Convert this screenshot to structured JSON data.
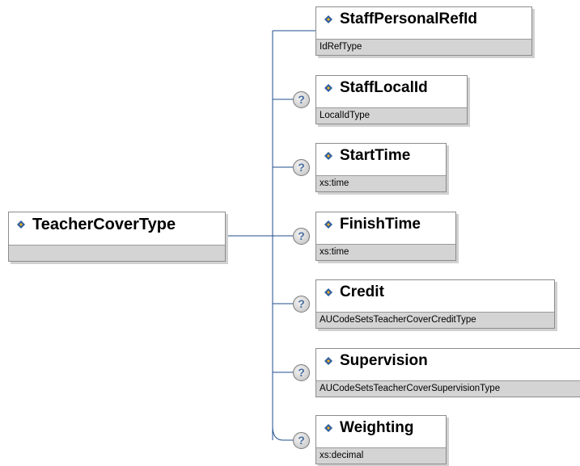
{
  "root": {
    "name": "TeacherCoverType",
    "type": ""
  },
  "children": [
    {
      "name": "StaffPersonalRefId",
      "type": "IdRefType",
      "optional": false
    },
    {
      "name": "StaffLocalId",
      "type": "LocalIdType",
      "optional": true
    },
    {
      "name": "StartTime",
      "type": "xs:time",
      "optional": true
    },
    {
      "name": "FinishTime",
      "type": "xs:time",
      "optional": true
    },
    {
      "name": "Credit",
      "type": "AUCodeSetsTeacherCoverCreditType",
      "optional": true
    },
    {
      "name": "Supervision",
      "type": "AUCodeSetsTeacherCoverSupervisionType",
      "optional": true
    },
    {
      "name": "Weighting",
      "type": "xs:decimal",
      "optional": true
    }
  ],
  "optional_marker": "?",
  "colors": {
    "connector": "#1f4e8c",
    "type_bar": "#d4d4d4",
    "icon_blue": "#2f5f9e",
    "icon_gold": "#f2b01e"
  }
}
